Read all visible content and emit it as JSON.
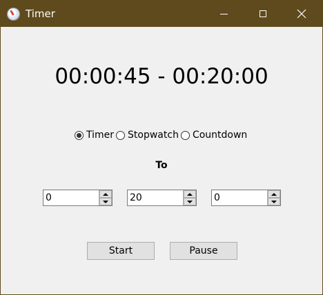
{
  "window": {
    "title": "Timer",
    "icon": "stopwatch-icon",
    "controls": [
      "minimize-icon",
      "maximize-icon",
      "close-icon"
    ],
    "titlebar_color": "#5e4a1c"
  },
  "display": {
    "text": "00:00:45 - 00:20:00"
  },
  "modes": {
    "options": [
      {
        "label": "Timer",
        "selected": true
      },
      {
        "label": "Stopwatch",
        "selected": false
      },
      {
        "label": "Countdown",
        "selected": false
      }
    ]
  },
  "to_label": "To",
  "fields": {
    "hours": "0",
    "minutes": "20",
    "seconds": "0"
  },
  "buttons": {
    "start": "Start",
    "pause": "Pause"
  }
}
